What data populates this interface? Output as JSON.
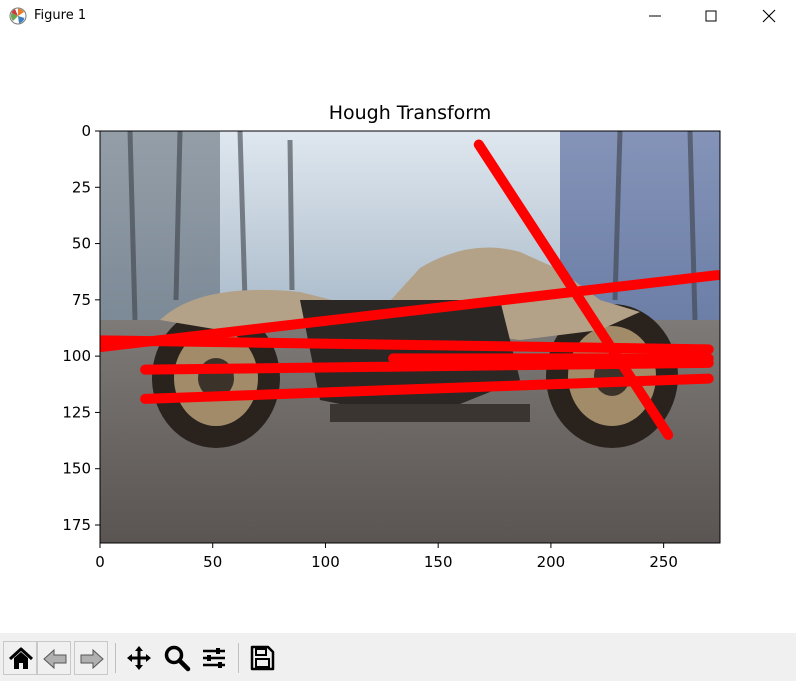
{
  "window": {
    "title": "Figure 1"
  },
  "colors": {
    "line": "#ff0000",
    "axis": "#000000",
    "background": "#ffffff",
    "toolbar": "#f0f0f0"
  },
  "toolbar": {
    "buttons": [
      "home-icon",
      "back-icon",
      "forward-icon",
      "pan-icon",
      "zoom-icon",
      "configure-subplots-icon",
      "save-icon"
    ]
  },
  "chart_data": {
    "type": "image",
    "title": "Hough Transform",
    "xlabel": "",
    "ylabel": "",
    "xlim": [
      0,
      275
    ],
    "ylim": [
      183,
      0
    ],
    "x_ticks": [
      0,
      50,
      100,
      150,
      200,
      250
    ],
    "y_ticks": [
      0,
      25,
      50,
      75,
      100,
      125,
      150,
      175
    ],
    "image_description": "motorcycle on road with trees in background",
    "lines": [
      {
        "x": [
          168,
          252
        ],
        "y": [
          6,
          135
        ]
      },
      {
        "x": [
          0,
          274
        ],
        "y": [
          96,
          64
        ]
      },
      {
        "x": [
          0,
          270
        ],
        "y": [
          93,
          97
        ]
      },
      {
        "x": [
          20,
          270
        ],
        "y": [
          106,
          103
        ]
      },
      {
        "x": [
          20,
          270
        ],
        "y": [
          119,
          110
        ]
      },
      {
        "x": [
          130,
          270
        ],
        "y": [
          101,
          101
        ]
      }
    ]
  }
}
